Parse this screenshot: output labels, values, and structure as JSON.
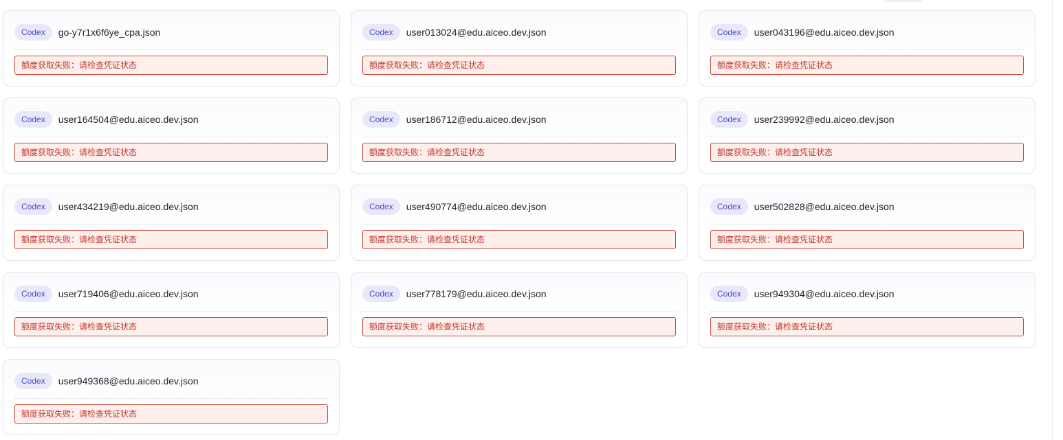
{
  "badge_label": "Codex",
  "status_text": "额度获取失败：请检查凭证状态",
  "colors": {
    "badge_bg": "#e9e8fb",
    "badge_text": "#4d4bc6",
    "error_border": "#c9483a",
    "error_bg": "#fdefec",
    "error_text": "#c0392b"
  },
  "cards": [
    {
      "filename": "go-y7r1x6f6ye_cpa.json"
    },
    {
      "filename": "user013024@edu.aiceo.dev.json"
    },
    {
      "filename": "user043196@edu.aiceo.dev.json"
    },
    {
      "filename": "user164504@edu.aiceo.dev.json"
    },
    {
      "filename": "user186712@edu.aiceo.dev.json"
    },
    {
      "filename": "user239992@edu.aiceo.dev.json"
    },
    {
      "filename": "user434219@edu.aiceo.dev.json"
    },
    {
      "filename": "user490774@edu.aiceo.dev.json"
    },
    {
      "filename": "user502828@edu.aiceo.dev.json"
    },
    {
      "filename": "user719406@edu.aiceo.dev.json"
    },
    {
      "filename": "user778179@edu.aiceo.dev.json"
    },
    {
      "filename": "user949304@edu.aiceo.dev.json"
    },
    {
      "filename": "user949368@edu.aiceo.dev.json"
    }
  ]
}
